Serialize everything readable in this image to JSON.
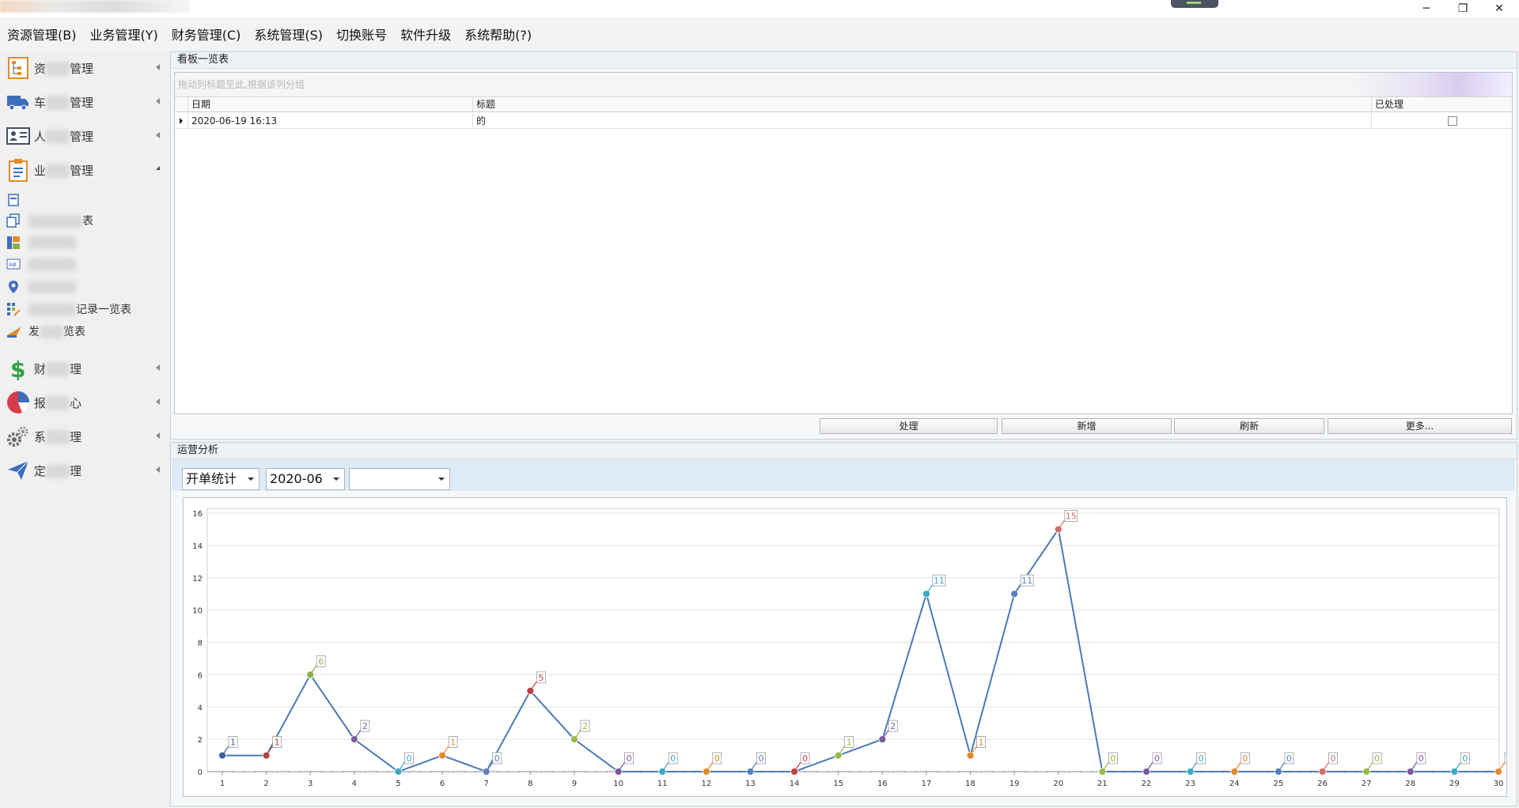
{
  "menu": [
    "资源管理(B)",
    "业务管理(Y)",
    "财务管理(C)",
    "系统管理(S)",
    "切换账号",
    "软件升级",
    "系统帮助(?)"
  ],
  "window_controls": {
    "minimize": "─",
    "restore": "❐",
    "close": "✕"
  },
  "sidebar": {
    "groups": [
      {
        "label_a": "资",
        "label_b": "管理",
        "icon": "resource-tree-icon"
      },
      {
        "label_a": "车",
        "label_b": "管理",
        "icon": "truck-icon"
      },
      {
        "label_a": "人",
        "label_b": "管理",
        "icon": "person-card-icon"
      },
      {
        "label_a": "业",
        "label_b": "管理",
        "icon": "clipboard-icon"
      }
    ],
    "sub_items": [
      {
        "label": "",
        "icon": "doc-icon"
      },
      {
        "label": "表",
        "icon": "copy-icon"
      },
      {
        "label": "表",
        "icon": "board-icon"
      },
      {
        "label": "表",
        "icon": "ab-icon"
      },
      {
        "label": "表",
        "icon": "location-pin-icon"
      },
      {
        "label": "记录一览表",
        "icon": "grid-edit-icon"
      },
      {
        "label_a": "发",
        "label_b": "览表",
        "icon": "dispatch-icon"
      }
    ],
    "groups2": [
      {
        "label_a": "财",
        "label_b": "理",
        "icon": "dollar-icon"
      },
      {
        "label_a": "报",
        "label_b": "心",
        "icon": "pie-chart-icon"
      },
      {
        "label_a": "系",
        "label_b": "理",
        "icon": "gears-icon"
      },
      {
        "label_a": "定",
        "label_b": "理",
        "icon": "paper-plane-icon"
      }
    ]
  },
  "board": {
    "title": "看板一览表",
    "group_hint": "拖动列标题至此,根据该列分组",
    "columns": [
      "日期",
      "标题",
      "已处理"
    ],
    "rows": [
      {
        "date": "2020-06-19 16:13",
        "title": "的",
        "handled": false
      }
    ],
    "buttons": [
      "处理",
      "新增",
      "刷新",
      "更多..."
    ]
  },
  "analysis": {
    "title": "运营分析",
    "filter_type": "开单统计",
    "filter_month": "2020-06",
    "filter_extra": ""
  },
  "chart_data": {
    "type": "line",
    "x": [
      1,
      2,
      3,
      4,
      5,
      6,
      7,
      8,
      9,
      10,
      11,
      12,
      13,
      14,
      15,
      16,
      17,
      18,
      19,
      20,
      21,
      22,
      23,
      24,
      25,
      26,
      27,
      28,
      29,
      30
    ],
    "values": [
      1,
      1,
      6,
      2,
      0,
      1,
      0,
      5,
      2,
      0,
      0,
      0,
      0,
      0,
      1,
      2,
      11,
      1,
      11,
      15,
      0,
      0,
      0,
      0,
      0,
      0,
      0,
      0,
      0,
      0
    ],
    "ylim": [
      0,
      16
    ],
    "yticks": [
      0,
      2,
      4,
      6,
      8,
      10,
      12,
      14,
      16
    ],
    "grid": true,
    "line_color": "#4a7ab5",
    "point_colors": [
      "#3b5fa8",
      "#b04444",
      "#8fb04a",
      "#7a5ba0",
      "#3ca8c8",
      "#e58a2c",
      "#5a7fc0",
      "#c04040",
      "#9ab84a",
      "#7a5ba0",
      "#3ca8c8",
      "#e58a2c",
      "#5a7fc0",
      "#c04040",
      "#9ab84a",
      "#7a5ba0",
      "#3ca8c8",
      "#e58a2c",
      "#5a7fc0",
      "#d46b6b",
      "#9ab84a",
      "#7a5ba0",
      "#3ca8c8",
      "#e58a2c",
      "#5a7fc0",
      "#d46b6b",
      "#9ab84a",
      "#7a5ba0",
      "#3ca8c8",
      "#e58a2c"
    ]
  }
}
